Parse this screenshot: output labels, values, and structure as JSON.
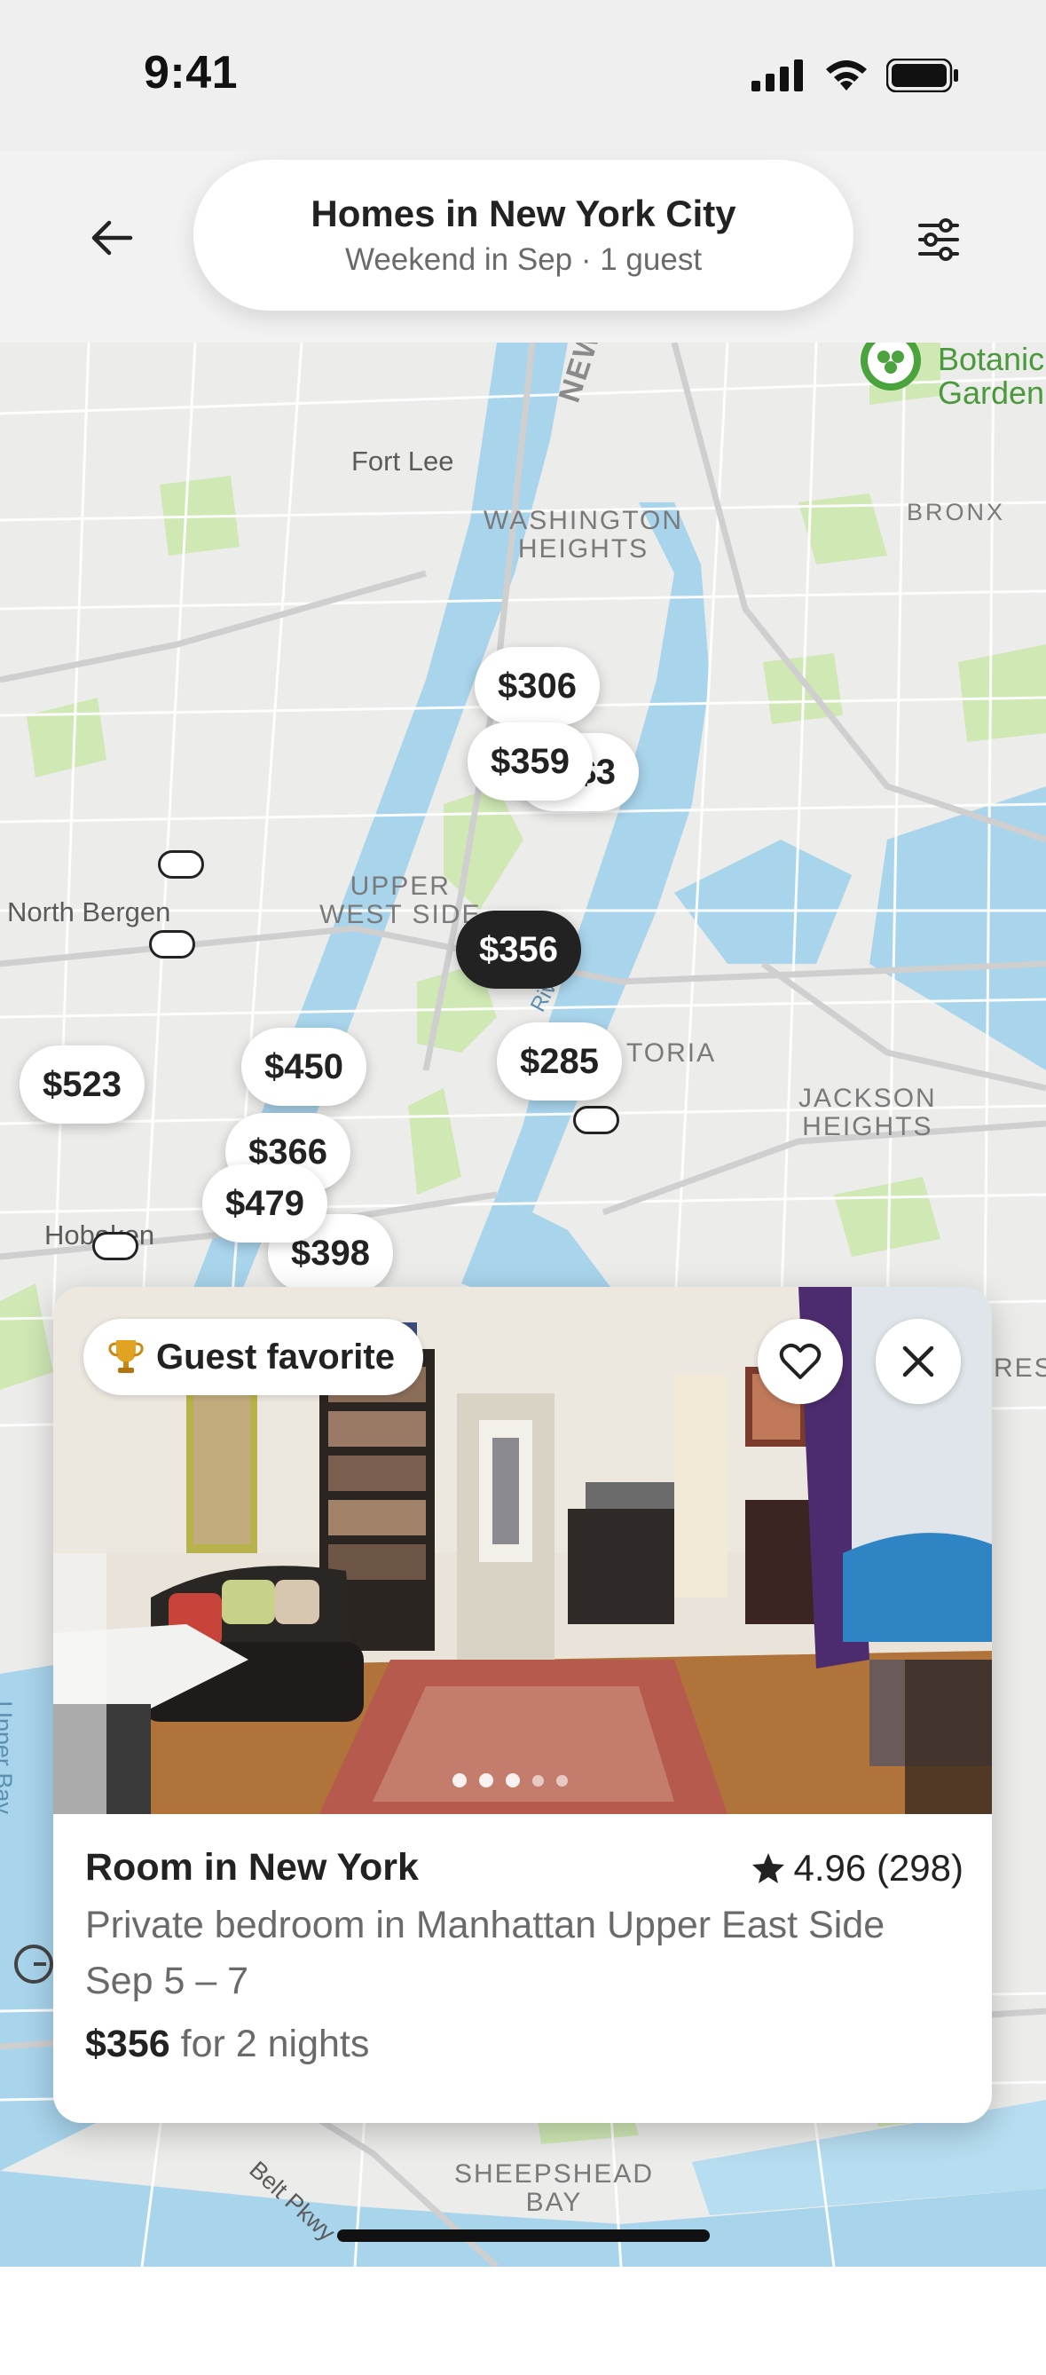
{
  "status_bar": {
    "time": "9:41",
    "icons": [
      "signal-icon",
      "wifi-icon",
      "battery-icon"
    ]
  },
  "header": {
    "title": "Homes in New York City",
    "subtitle": "Weekend in Sep · 1 guest",
    "back_icon": "arrow-left-icon",
    "filter_icon": "filter-sliders-icon"
  },
  "map": {
    "labels": {
      "fort_lee": "Fort Lee",
      "washington_heights": "WASHINGTON\nHEIGHTS",
      "bronx": "BRONX",
      "botanical": "Botanic\nGarden",
      "new_jersey_tpk": "NEW",
      "north_bergen": "North Bergen",
      "upper_west_side": "UPPER\nWEST SIDE",
      "astoria": "TORIA",
      "jackson_heights": "JACKSON\nHEIGHTS",
      "hoboken": "Hoboken",
      "sheepshead_bay": "SHEEPSHEAD\nBAY",
      "belt_pkwy": "Belt Pkwy",
      "upper_bay": "Upper Bay",
      "river": "River",
      "queens_right": "RES"
    },
    "pins": [
      "$306",
      "$359",
      "$3",
      "$356",
      "$523",
      "$450",
      "$285",
      "$366",
      "$479",
      "$398"
    ],
    "selected_pin": "$356"
  },
  "listing": {
    "badge_icon": "trophy-icon",
    "badge_label": "Guest favorite",
    "title": "Room in New York",
    "rating": "4.96 (298)",
    "description": "Private bedroom in Manhattan Upper East Side",
    "dates": "Sep 5 – 7",
    "price": "$356",
    "price_suffix": "for 2 nights",
    "photo_count": 5,
    "current_photo": 1
  },
  "colors": {
    "accent": "#222222",
    "map_water": "#a8d4ec",
    "map_park": "#cfe8b4",
    "map_land": "#ececea"
  }
}
